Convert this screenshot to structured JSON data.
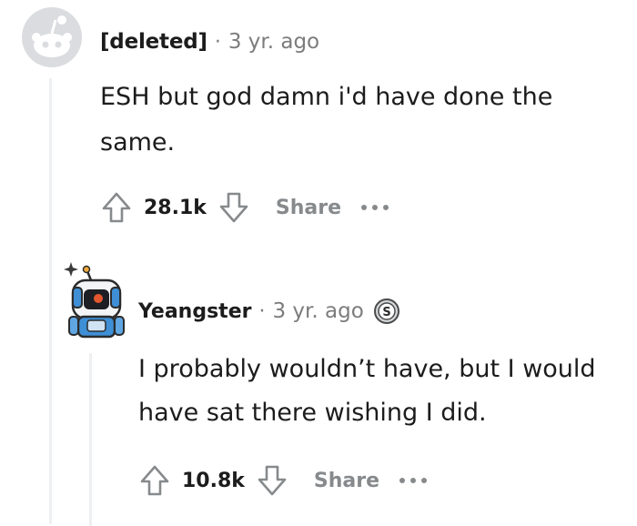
{
  "comments": [
    {
      "author": "[deleted]",
      "separator": "·",
      "time": "3 yr. ago",
      "body": "ESH but god damn i'd have done the same.",
      "score": "28.1k",
      "share_label": "Share",
      "avatar_icon": "reddit-default-avatar-icon"
    },
    {
      "author": "Yeangster",
      "separator": "·",
      "time": "3 yr. ago",
      "badge": "S",
      "badge_icon": "coin-award-icon",
      "body": "I probably wouldn’t have, but I would have sat there wishing I did.",
      "score": "10.8k",
      "share_label": "Share",
      "avatar_icon": "robot-snoo-avatar-icon"
    }
  ],
  "colors": {
    "text": "#1c1c1c",
    "meta": "#7c7c7c",
    "share": "#878a8c",
    "icon": "#878a8c",
    "thread_line": "#edeff1",
    "avatar_bg": "#dadcdf"
  }
}
